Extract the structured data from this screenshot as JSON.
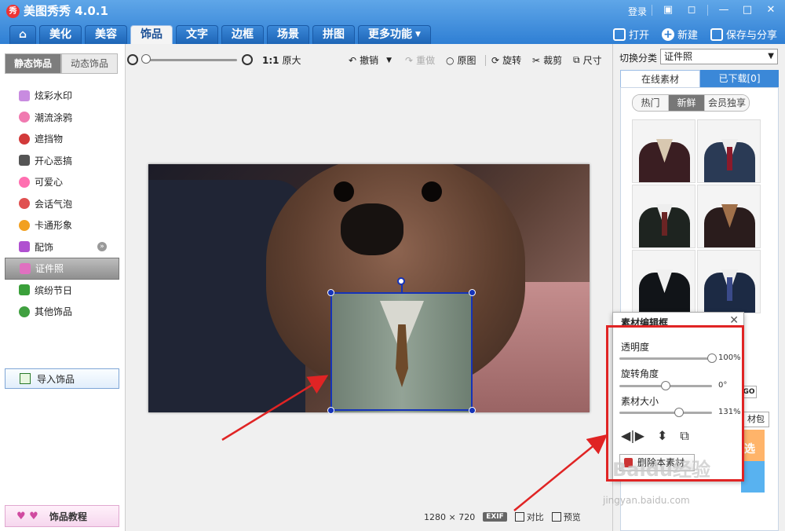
{
  "window": {
    "title": "美图秀秀 4.0.1",
    "logo_text": "秀",
    "login": "登录"
  },
  "nav": {
    "tabs": [
      {
        "label": "美化"
      },
      {
        "label": "美容"
      },
      {
        "label": "饰品"
      },
      {
        "label": "文字"
      },
      {
        "label": "边框"
      },
      {
        "label": "场景"
      },
      {
        "label": "拼图"
      },
      {
        "label": "更多功能"
      }
    ],
    "actions": {
      "open": "打开",
      "new": "新建",
      "save": "保存与分享"
    }
  },
  "sidebar": {
    "tabs": {
      "static": "静态饰品",
      "dynamic": "动态饰品"
    },
    "items": [
      {
        "label": "炫彩水印",
        "color": "#c88be0"
      },
      {
        "label": "潮流涂鸦",
        "color": "#f07ab0"
      },
      {
        "label": "遮挡物",
        "color": "#d23a3a"
      },
      {
        "label": "开心恶搞",
        "color": "#555555"
      },
      {
        "label": "可爱心",
        "color": "#ff6fb0"
      },
      {
        "label": "会话气泡",
        "color": "#e05050"
      },
      {
        "label": "卡通形象",
        "color": "#f2a020"
      },
      {
        "label": "配饰",
        "color": "#b050d0"
      },
      {
        "label": "证件照",
        "color": "#e070c0"
      },
      {
        "label": "缤纷节日",
        "color": "#3aa03a"
      },
      {
        "label": "其他饰品",
        "color": "#40a040"
      }
    ],
    "import_label": "导入饰品",
    "tutorial_label": "饰品教程"
  },
  "toolbar": {
    "ratio": "1:1",
    "original_size": "原大",
    "undo": "撤销",
    "redo": "重做",
    "original": "原图",
    "rotate": "旋转",
    "crop": "裁剪",
    "size": "尺寸"
  },
  "status": {
    "width": "1280",
    "x": "×",
    "height": "720",
    "exif": "EXIF",
    "compare": "对比",
    "preview": "预览"
  },
  "rightpanel": {
    "switch_label": "切换分类",
    "switch_value": "证件照",
    "tabs": {
      "online": "在线素材",
      "downloaded": "已下载[0]"
    },
    "subtabs": [
      "热门",
      "新鲜",
      "会员独享"
    ],
    "thumbs": [
      {
        "jacket": "#3a1e22",
        "tie": "#d8c8b0"
      },
      {
        "jacket": "#2a3a55",
        "tie": "#8b1a2a"
      },
      {
        "jacket": "#1e2420",
        "tie": "#6a2424"
      },
      {
        "jacket": "#2a1c1c",
        "tie": "#a0704a"
      },
      {
        "jacket": "#111418",
        "tie": "#f0f0f0"
      },
      {
        "jacket": "#1c2a44",
        "tie": "#3a4a8a"
      }
    ],
    "go_text": "GO",
    "pack_text": "材包",
    "select_text": "选"
  },
  "editor": {
    "title": "素材编辑框",
    "opacity_label": "透明度",
    "opacity_value": "100%",
    "opacity": 1.0,
    "rotation_label": "旋转角度",
    "rotation_value": "0°",
    "rotation": 0.5,
    "size_label": "素材大小",
    "size_value": "131%",
    "size": 0.64,
    "delete_label": "删除本素材"
  },
  "watermark": {
    "brand": "Baidu经验",
    "url": "jingyan.baidu.com"
  },
  "colors": {
    "accent": "#2f7fd4",
    "selection": "#1533b8",
    "highlight": "#e02424"
  }
}
